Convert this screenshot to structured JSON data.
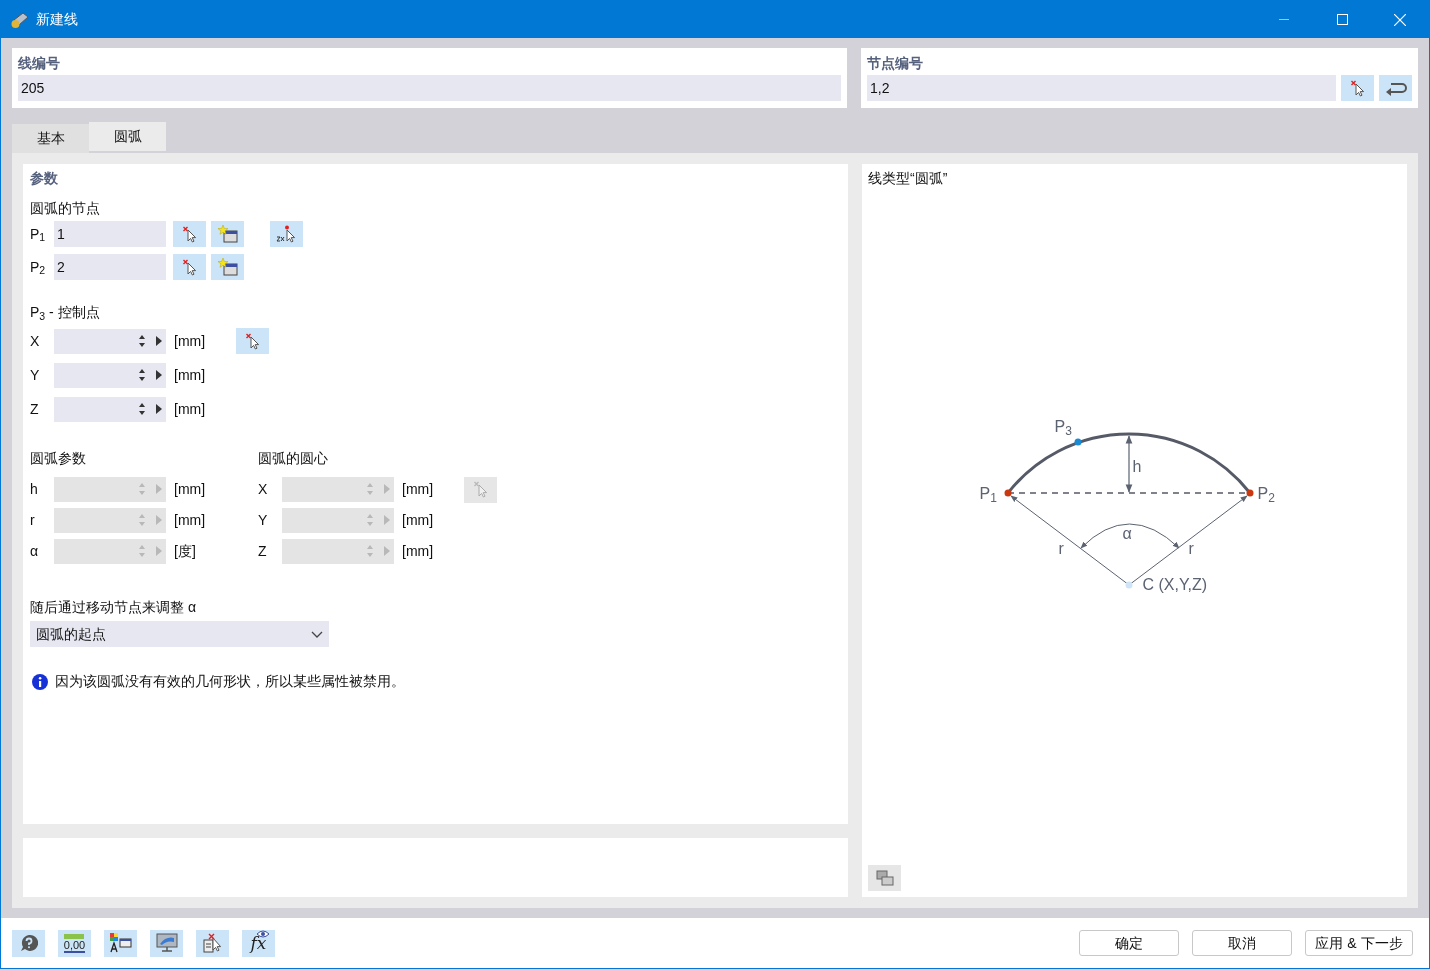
{
  "window": {
    "title": "新建线"
  },
  "line_number": {
    "label": "线编号",
    "value": "205"
  },
  "node_numbers": {
    "label": "节点编号",
    "value": "1,2"
  },
  "tabs": [
    {
      "label": "基本",
      "selected": false
    },
    {
      "label": "圆弧",
      "selected": true
    }
  ],
  "parameters": {
    "title": "参数",
    "arc_nodes": {
      "label": "圆弧的节点",
      "rows": [
        {
          "label": "P$_{1}$",
          "value": "1"
        },
        {
          "label": "P$_{2}$",
          "value": "2"
        }
      ]
    },
    "control_point": {
      "label": "P$_{3}$ - 控制点",
      "pick_disabled": false,
      "rows": [
        {
          "label": "X",
          "unit": "[mm]",
          "disabled": false
        },
        {
          "label": "Y",
          "unit": "[mm]",
          "disabled": false
        },
        {
          "label": "Z",
          "unit": "[mm]",
          "disabled": false
        }
      ]
    },
    "arc_parameters": {
      "label": "圆弧参数",
      "rows": [
        {
          "label": "h",
          "unit": "[mm]",
          "disabled": true
        },
        {
          "label": "r",
          "unit": "[mm]",
          "disabled": true
        },
        {
          "label": "α",
          "unit": "[度]",
          "disabled": true
        }
      ]
    },
    "arc_center": {
      "label": "圆弧的圆心",
      "pick_disabled": true,
      "rows": [
        {
          "label": "X",
          "unit": "[mm]",
          "disabled": true
        },
        {
          "label": "Y",
          "unit": "[mm]",
          "disabled": true
        },
        {
          "label": "Z",
          "unit": "[mm]",
          "disabled": true
        }
      ]
    },
    "adjust": {
      "label": "随后通过移动节点来调整 α",
      "value": "圆弧的起点"
    },
    "info": "因为该圆弧没有有效的几何形状，所以某些属性被禁用。"
  },
  "preview": {
    "title": "线类型“圆弧”",
    "labels": {
      "p1": "P$_{1}$",
      "p2": "P$_{2}$",
      "p3": "P$_{3}$",
      "h": "h",
      "alpha": "α",
      "r_left": "r",
      "r_right": "r",
      "center": "C (X,Y,Z)"
    }
  },
  "tools": [
    {
      "kind": "help"
    },
    {
      "kind": "units",
      "text": "0,00"
    },
    {
      "kind": "display"
    },
    {
      "kind": "view"
    },
    {
      "kind": "pick_document"
    },
    {
      "kind": "formula",
      "text": "fx"
    }
  ],
  "buttons": [
    "确定",
    "取消",
    "应用 & 下一步"
  ]
}
